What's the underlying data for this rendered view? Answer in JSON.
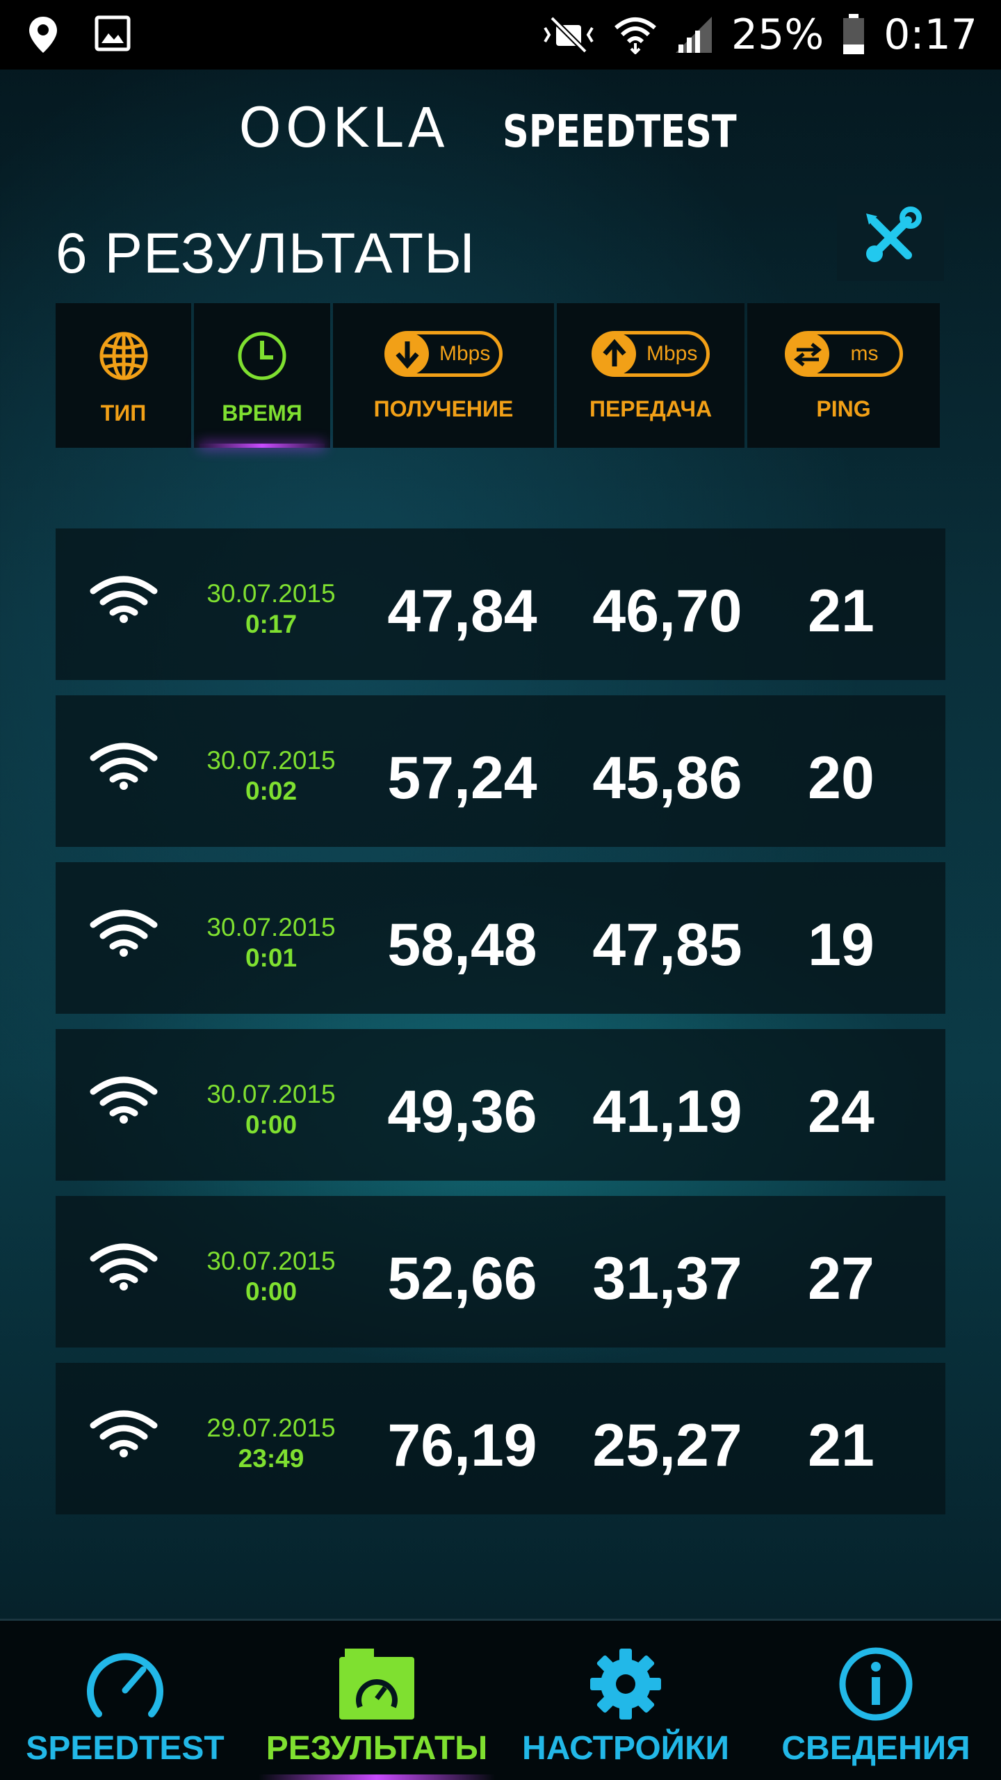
{
  "status_bar": {
    "battery": "25%",
    "time": "0:17",
    "icons": [
      "location-icon",
      "image-icon",
      "mute-icon",
      "wifi-icon",
      "signal-icon",
      "battery-icon"
    ]
  },
  "logo": {
    "brand": "OOKLA",
    "product": "SPEEDTEST"
  },
  "page": {
    "title": "6 РЕЗУЛЬТАТЫ"
  },
  "sort_columns": [
    {
      "label": "ТИП",
      "icon": "globe-icon",
      "active": false
    },
    {
      "label": "ВРЕМЯ",
      "icon": "clock-icon",
      "active": true
    },
    {
      "label": "ПОЛУЧЕНИЕ",
      "icon": "download-icon",
      "unit": "Mbps",
      "active": false
    },
    {
      "label": "ПЕРЕДАЧА",
      "icon": "upload-icon",
      "unit": "Mbps",
      "active": false
    },
    {
      "label": "PING",
      "icon": "ping-icon",
      "unit": "ms",
      "active": false
    }
  ],
  "results": [
    {
      "type": "wifi",
      "date": "30.07.2015",
      "time": "0:17",
      "download": "47,84",
      "upload": "46,70",
      "ping": "21"
    },
    {
      "type": "wifi",
      "date": "30.07.2015",
      "time": "0:02",
      "download": "57,24",
      "upload": "45,86",
      "ping": "20"
    },
    {
      "type": "wifi",
      "date": "30.07.2015",
      "time": "0:01",
      "download": "58,48",
      "upload": "47,85",
      "ping": "19"
    },
    {
      "type": "wifi",
      "date": "30.07.2015",
      "time": "0:00",
      "download": "49,36",
      "upload": "41,19",
      "ping": "24"
    },
    {
      "type": "wifi",
      "date": "30.07.2015",
      "time": "0:00",
      "download": "52,66",
      "upload": "31,37",
      "ping": "27"
    },
    {
      "type": "wifi",
      "date": "29.07.2015",
      "time": "23:49",
      "download": "76,19",
      "upload": "25,27",
      "ping": "21"
    }
  ],
  "bottom_nav": [
    {
      "label": "SPEEDTEST",
      "icon": "speedometer-icon",
      "active": false
    },
    {
      "label": "РЕЗУЛЬТАТЫ",
      "icon": "results-folder-icon",
      "active": true
    },
    {
      "label": "НАСТРОЙКИ",
      "icon": "gear-icon",
      "active": false
    },
    {
      "label": "СВЕДЕНИЯ",
      "icon": "info-icon",
      "active": false
    }
  ],
  "colors": {
    "accent_orange": "#f2a017",
    "accent_green": "#7fe030",
    "accent_blue": "#22b8e8",
    "accent_purple": "#c94bff"
  }
}
